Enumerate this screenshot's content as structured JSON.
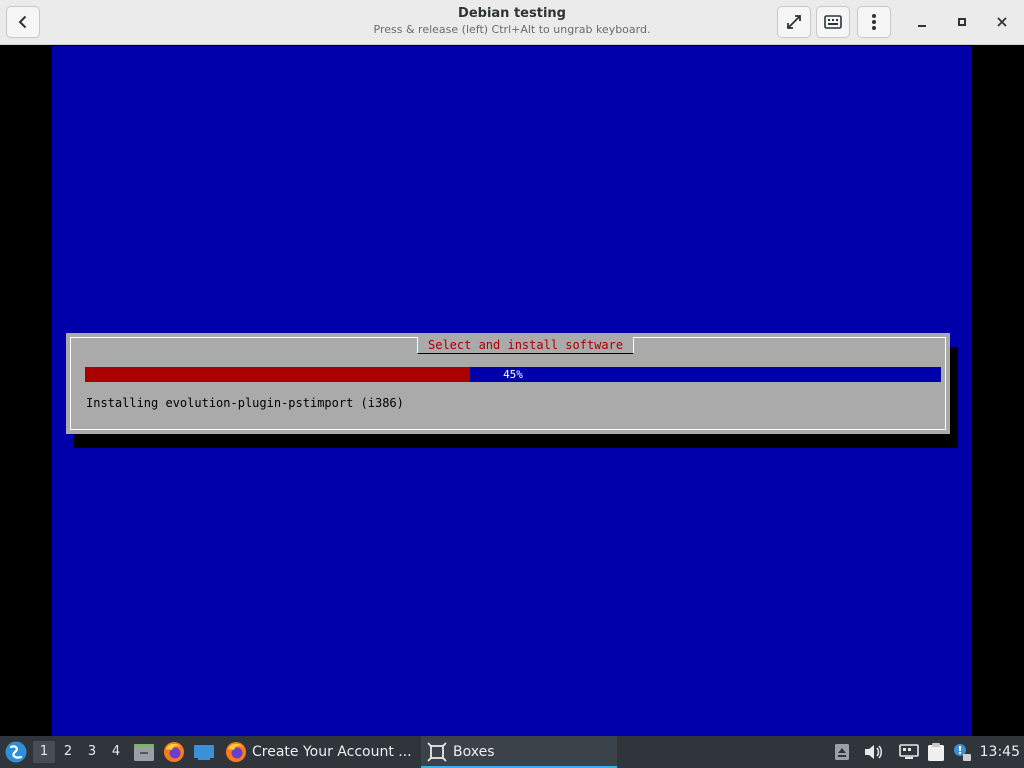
{
  "window": {
    "title": "Debian testing",
    "subtitle": "Press & release (left) Ctrl+Alt to ungrab keyboard."
  },
  "headerbar": {
    "back_icon": "chevron-left-icon",
    "fullscreen_icon": "fullscreen-icon",
    "keyboard_icon": "keyboard-icon",
    "menu_icon": "kebab-menu-icon"
  },
  "installer": {
    "dialog_title": "Select and install software",
    "progress_percent": 45,
    "progress_label": "45%",
    "status_text": "Installing evolution-plugin-pstimport (i386)",
    "colors": {
      "screen_bg": "#0000aa",
      "dialog_bg": "#aaaaaa",
      "title_text": "#aa0000",
      "progress_fill": "#aa0000",
      "progress_track": "#0000aa"
    }
  },
  "taskbar": {
    "desktops": [
      "1",
      "2",
      "3",
      "4"
    ],
    "active_desktop": "1",
    "quick_launch": [
      "file-manager-icon",
      "firefox-icon",
      "desktop-icon"
    ],
    "tasks": [
      {
        "label": "Create Your Account ...",
        "icon": "firefox-icon"
      },
      {
        "label": "Boxes",
        "icon": "boxes-icon"
      }
    ],
    "tray": [
      "storage-icon",
      "volume-icon",
      "network-icon",
      "clipboard-icon",
      "updates-icon"
    ],
    "clock": "13:45"
  }
}
